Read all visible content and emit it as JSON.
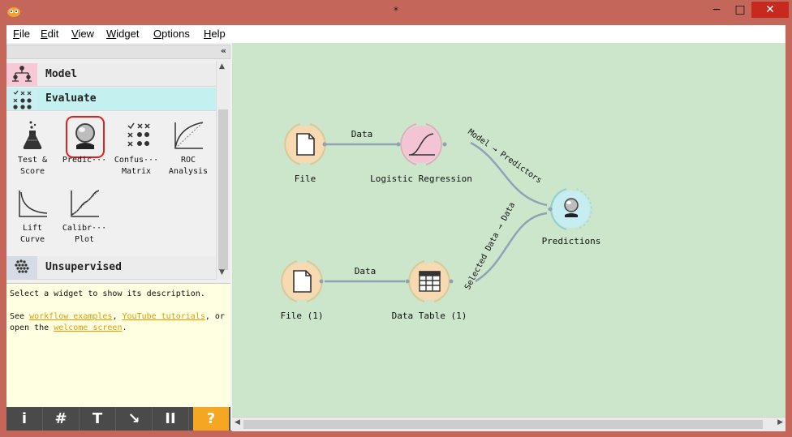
{
  "window": {
    "title": "*",
    "min_glyph": "−",
    "max_glyph": "□",
    "close_glyph": "✕"
  },
  "menu": [
    {
      "accel": "F",
      "rest": "ile"
    },
    {
      "accel": "E",
      "rest": "dit"
    },
    {
      "accel": "V",
      "rest": "iew"
    },
    {
      "accel": "W",
      "rest": "idget"
    },
    {
      "accel": "O",
      "rest": "ptions"
    },
    {
      "accel": "H",
      "rest": "elp"
    }
  ],
  "dock": {
    "collapse_glyph": "«",
    "categories": {
      "model": "Model",
      "evaluate": "Evaluate",
      "unsupervised": "Unsupervised"
    },
    "tools": [
      {
        "label": "Test &\nScore"
      },
      {
        "label": "Predic···"
      },
      {
        "label": "Confus···\nMatrix"
      },
      {
        "label": "ROC\nAnalysis"
      },
      {
        "label": "Lift\nCurve"
      },
      {
        "label": "Calibr···\nPlot"
      }
    ],
    "scroll_up": "▲",
    "scroll_down": "▼",
    "description": {
      "line1": "Select a widget to show its description.",
      "see": "See ",
      "link1": "workflow examples",
      "comma": ", ",
      "link2": "YouTube tutorials",
      "or": ", or",
      "open": "open the ",
      "link3": "welcome screen",
      "period": "."
    },
    "bottom_buttons": [
      "i",
      "#",
      "T",
      "↘",
      "II",
      "?"
    ]
  },
  "canvas": {
    "nodes": {
      "file": "File",
      "logreg": "Logistic Regression",
      "predictions": "Predictions",
      "file1": "File (1)",
      "datatable": "Data Table (1)"
    },
    "links": {
      "file_logreg": "Data",
      "logreg_pred": "Model → Predictors",
      "file1_table": "Data",
      "table_pred": "Selected Data → Data"
    },
    "scroll_left": "◀",
    "scroll_right": "▶"
  },
  "colors": {
    "canvas_bg": "#cbe6cb",
    "node_orange": "#f8d9b0",
    "node_pink": "#f5c4d4",
    "node_cyan": "#c6eef2",
    "link": "#8fa3b5",
    "help_accent": "#f5a623"
  }
}
